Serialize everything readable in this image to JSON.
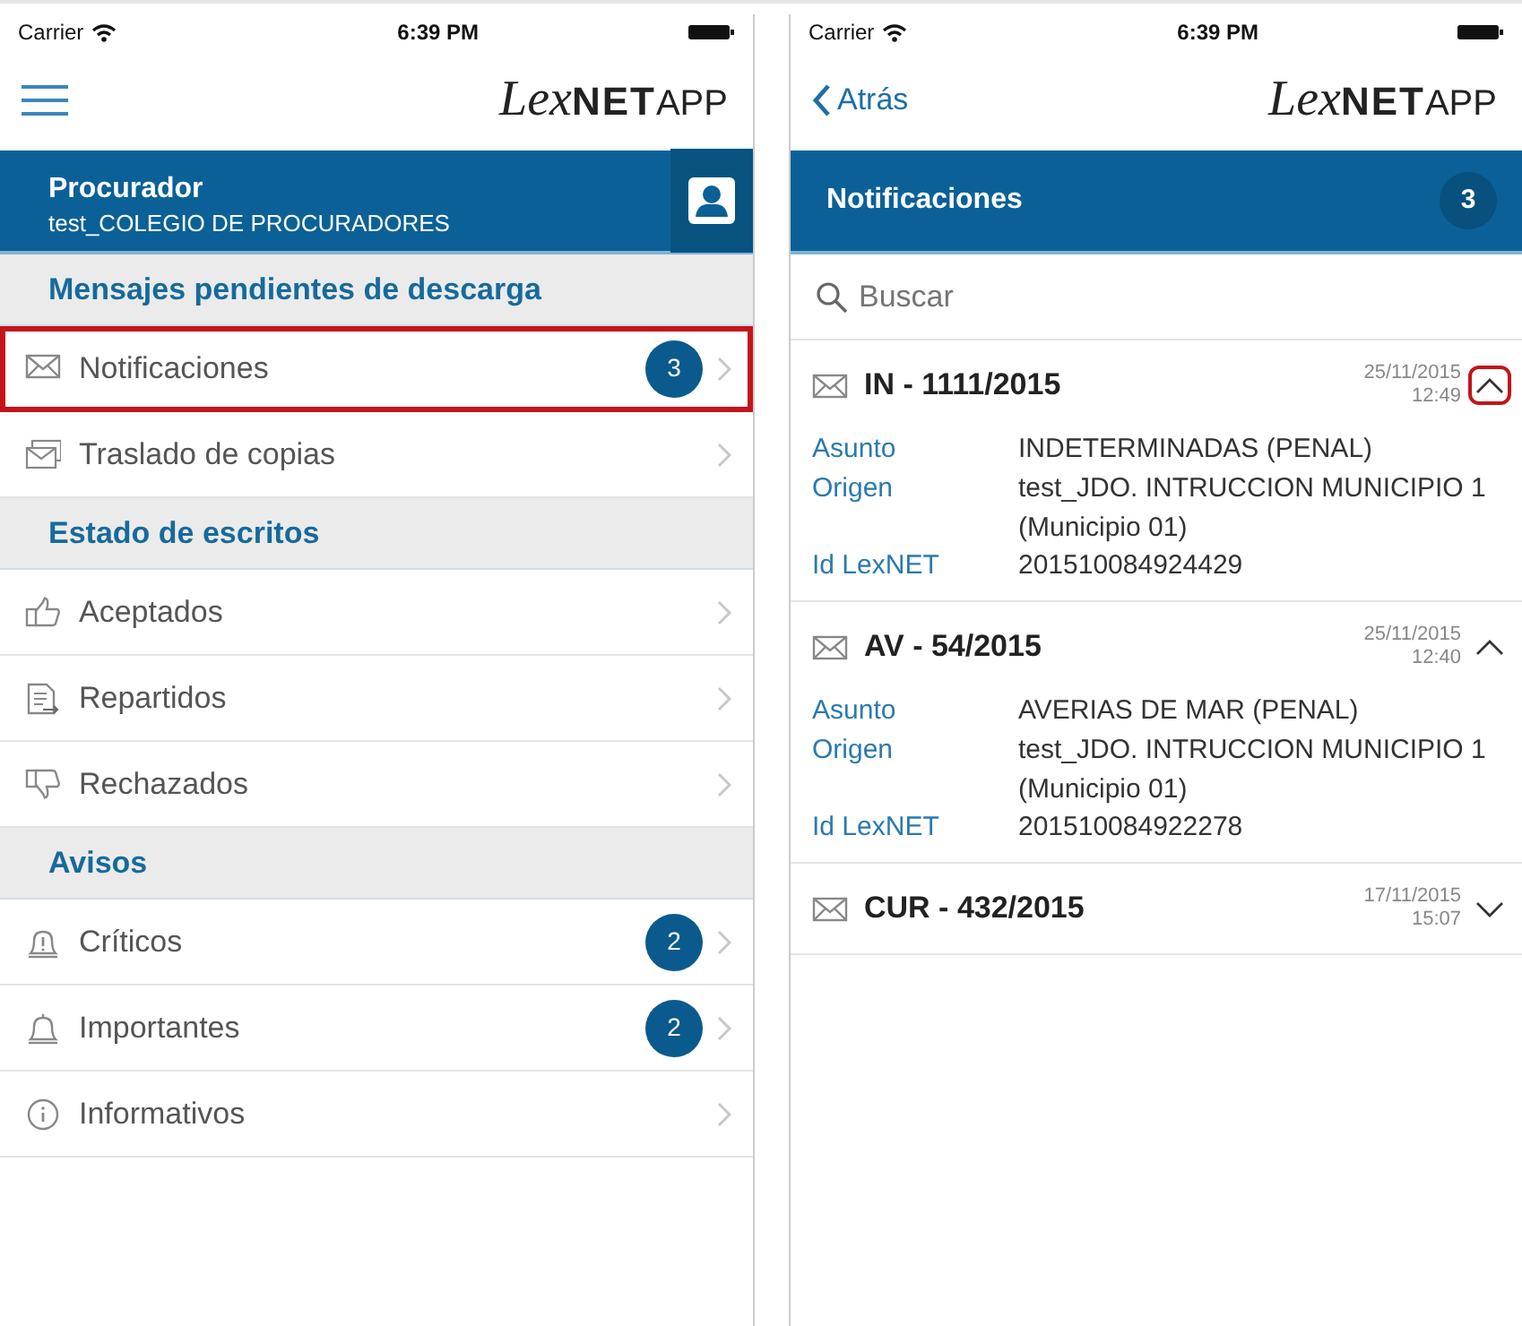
{
  "left_screen": {
    "status_bar": {
      "carrier": "Carrier",
      "time": "6:39 PM"
    },
    "nav_bar": {
      "logo": {
        "script": "Lex",
        "bold": "NET",
        "plain": "APP"
      }
    },
    "user_header": {
      "role": "Procurador",
      "organization": "test_COLEGIO DE PROCURADORES"
    },
    "sections": [
      {
        "title": "Mensajes pendientes de descarga",
        "items": [
          {
            "label": "Notificaciones",
            "badge": "3",
            "highlighted": true
          },
          {
            "label": "Traslado de copias",
            "highlighted": false
          }
        ]
      },
      {
        "title": "Estado de escritos",
        "items": [
          {
            "label": "Aceptados",
            "highlighted": false
          },
          {
            "label": "Repartidos",
            "highlighted": false
          },
          {
            "label": "Rechazados",
            "highlighted": false
          }
        ]
      },
      {
        "title": "Avisos",
        "items": [
          {
            "label": "Críticos",
            "badge": "2",
            "highlighted": false
          },
          {
            "label": "Importantes",
            "badge": "2",
            "highlighted": false
          },
          {
            "label": "Informativos",
            "highlighted": false
          }
        ]
      }
    ]
  },
  "right_screen": {
    "status_bar": {
      "carrier": "Carrier",
      "time": "6:39 PM"
    },
    "nav_bar": {
      "back": "Atrás",
      "logo": {
        "script": "Lex",
        "bold": "NET",
        "plain": "APP"
      }
    },
    "header": {
      "title": "Notificaciones",
      "count": "3"
    },
    "search": {
      "placeholder": "Buscar"
    },
    "notifications": [
      {
        "title": "IN - 1111/2015",
        "date": "25/11/2015",
        "time": "12:49",
        "expanded": true,
        "highlighted": true,
        "details": [
          {
            "label": "Asunto",
            "value": "INDETERMINADAS (PENAL)"
          },
          {
            "label": "Origen",
            "value": "test_JDO. INTRUCCION MUNICIPIO 1 (Municipio 01)"
          },
          {
            "label": "Id LexNET",
            "value": "201510084924429"
          }
        ]
      },
      {
        "title": "AV - 54/2015",
        "date": "25/11/2015",
        "time": "12:40",
        "expanded": true,
        "highlighted": false,
        "details": [
          {
            "label": "Asunto",
            "value": "AVERIAS DE MAR (PENAL)"
          },
          {
            "label": "Origen",
            "value": "test_JDO. INTRUCCION MUNICIPIO 1 (Municipio 01)"
          },
          {
            "label": "Id LexNET",
            "value": "201510084922278"
          }
        ]
      },
      {
        "title": "CUR - 432/2015",
        "date": "17/11/2015",
        "time": "15:07",
        "expanded": false,
        "highlighted": false
      }
    ]
  }
}
